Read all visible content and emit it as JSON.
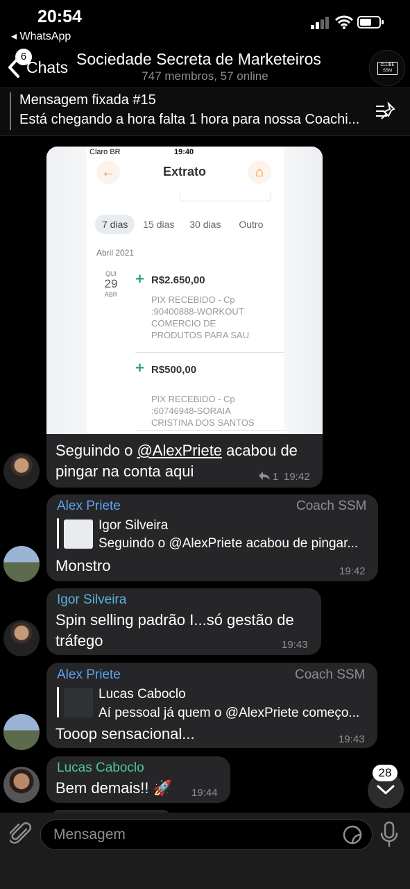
{
  "status": {
    "time": "20:54",
    "back_app": "◂ WhatsApp"
  },
  "header": {
    "back_count": "6",
    "back_label": "Chats",
    "title": "Sociedade Secreta de Marketeiros",
    "subtitle": "747 membros, 57 online",
    "avatar_text": "CLUBE SSM"
  },
  "pinned": {
    "title": "Mensagem fixada #15",
    "text": "Está chegando a hora falta 1 hora para nossa Coachi..."
  },
  "screenshot": {
    "carrier": "Claro BR",
    "time": "19:40",
    "title": "Extrato",
    "filters": [
      "7 dias",
      "15 dias",
      "30 dias",
      "Outro"
    ],
    "month": "Abril 2021",
    "weekday": "QUI",
    "day": "29",
    "month_short": "ABR",
    "transactions": [
      {
        "amount": "R$2.650,00",
        "desc": "PIX RECEBIDO - Cp :90400888-WORKOUT COMERCIO DE PRODUTOS PARA SAU"
      },
      {
        "amount": "R$500,00",
        "desc": "PIX RECEBIDO - Cp :60746948-SORAIA CRISTINA DOS SANTOS"
      }
    ]
  },
  "messages": [
    {
      "text_prefix": "Seguindo o ",
      "mention": "@AlexPriete",
      "text_suffix": " acabou de pingar na conta aqui",
      "replies": "1",
      "time": "19:42"
    },
    {
      "sender": "Alex Priete",
      "role": "Coach SSM",
      "reply_name": "Igor Silveira",
      "reply_text": "Seguindo o @AlexPriete acabou de pingar...",
      "text": "Monstro",
      "time": "19:42"
    },
    {
      "sender": "Igor Silveira",
      "text": "Spin selling padrão I...só gestão de tráfego",
      "time": "19:43"
    },
    {
      "sender": "Alex Priete",
      "role": "Coach SSM",
      "reply_name": "Lucas Caboclo",
      "reply_text": "Aí pessoal já quem o @AlexPriete começo...",
      "text": "Tooop sensacional...",
      "time": "19:43"
    },
    {
      "sender": "Lucas Caboclo",
      "text": "Bem demais!! 🚀",
      "time": "19:44"
    }
  ],
  "input": {
    "placeholder": "Mensagem"
  },
  "scroll_badge": "28",
  "colors": {
    "alex": "#5ea2ef",
    "igor": "#5bb3e0",
    "lucas": "#4cc79a",
    "bubble": "#262628"
  }
}
